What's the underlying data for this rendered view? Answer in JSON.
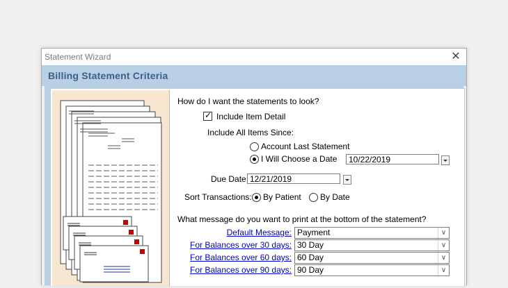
{
  "window": {
    "title": "Statement Wizard",
    "close_glyph": "✕"
  },
  "banner": {
    "title": "Billing Statement Criteria"
  },
  "form": {
    "look_question": "How do I want the statements to look?",
    "include_item_detail": {
      "label": "Include Item Detail",
      "checked": true
    },
    "include_since_label": "Include All Items Since:",
    "since_options": [
      {
        "label": "Account Last Statement",
        "selected": false
      },
      {
        "label": "I Will Choose a Date",
        "selected": true
      }
    ],
    "chosen_date": "10/22/2019",
    "due_date_label": "Due Date:",
    "due_date": "12/21/2019",
    "sort_label": "Sort Transactions:",
    "sort_options": [
      {
        "label": "By Patient",
        "selected": true
      },
      {
        "label": "By Date",
        "selected": false
      }
    ],
    "message_question": "What message do you want to print at the bottom of the statement?",
    "messages": [
      {
        "label": "Default Message:",
        "value": "Payment"
      },
      {
        "label": "For Balances over 30 days:",
        "value": "30 Day"
      },
      {
        "label": "For Balances over 60 days:",
        "value": "60 Day"
      },
      {
        "label": "For Balances over 90 days:",
        "value": "90 Day"
      }
    ]
  },
  "icons": {
    "close": "close-icon",
    "dropdown": "chevron-down-icon",
    "illustration": "statements-envelopes-illustration"
  },
  "colors": {
    "banner_bg": "#b9cfe4",
    "banner_text": "#3a5f8f",
    "illustration_bg": "#f8e7d0",
    "link": "#0000cc",
    "envelope_stamp": "#cc0000",
    "envelope_lines": "#2233aa"
  }
}
